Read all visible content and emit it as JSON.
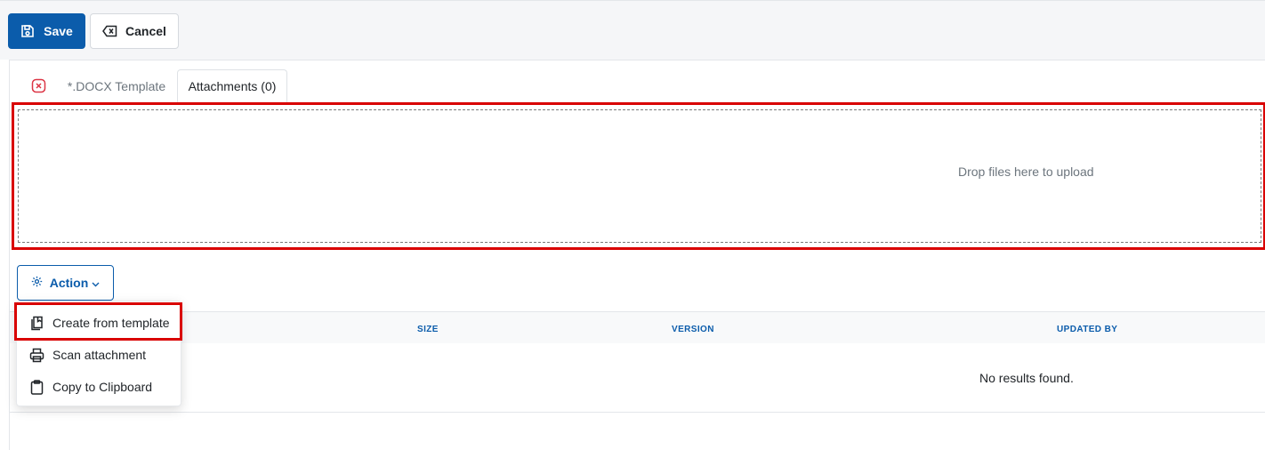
{
  "toolbar": {
    "save_label": "Save",
    "cancel_label": "Cancel"
  },
  "tabs": {
    "docx_label": "*.DOCX Template",
    "attachments_label": "Attachments (0)"
  },
  "dropzone": {
    "text": "Drop files here to upload"
  },
  "action": {
    "label": "Action"
  },
  "table": {
    "columns": [
      "SIZE",
      "VERSION",
      "UPDATED BY"
    ],
    "empty_text": "No results found."
  },
  "menu": {
    "items": [
      {
        "label": "Create from template",
        "icon": "template-icon"
      },
      {
        "label": "Scan attachment",
        "icon": "printer-icon"
      },
      {
        "label": "Copy to Clipboard",
        "icon": "clipboard-icon"
      }
    ]
  },
  "colors": {
    "primary": "#0b5cab",
    "highlight": "#d90000",
    "close_icon": "#dc3545"
  }
}
